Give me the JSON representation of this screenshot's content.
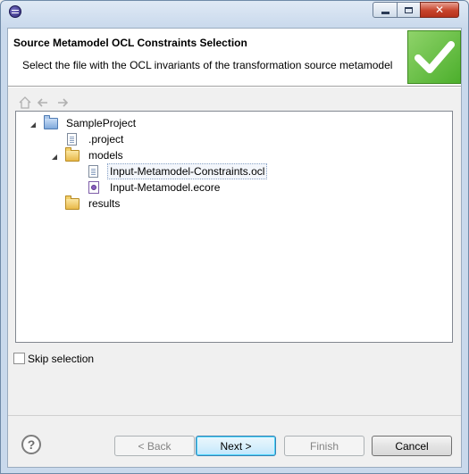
{
  "banner": {
    "title": "Source Metamodel OCL Constraints Selection",
    "description": "Select the file with the OCL invariants of the transformation source metamodel",
    "accent_color": "#5cbf3a"
  },
  "tree": {
    "nodes": [
      {
        "label": "SampleProject",
        "icon": "project-folder-icon",
        "expanded": true
      },
      {
        "label": ".project",
        "icon": "file-icon"
      },
      {
        "label": "models",
        "icon": "folder-icon",
        "expanded": true
      },
      {
        "label": "Input-Metamodel-Constraints.ocl",
        "icon": "file-icon",
        "selected": true
      },
      {
        "label": "Input-Metamodel.ecore",
        "icon": "ecore-file-icon"
      },
      {
        "label": "results",
        "icon": "folder-icon"
      }
    ]
  },
  "skip": {
    "label": "Skip selection",
    "checked": false
  },
  "buttons": {
    "back": "< Back",
    "next": "Next >",
    "finish": "Finish",
    "cancel": "Cancel"
  }
}
